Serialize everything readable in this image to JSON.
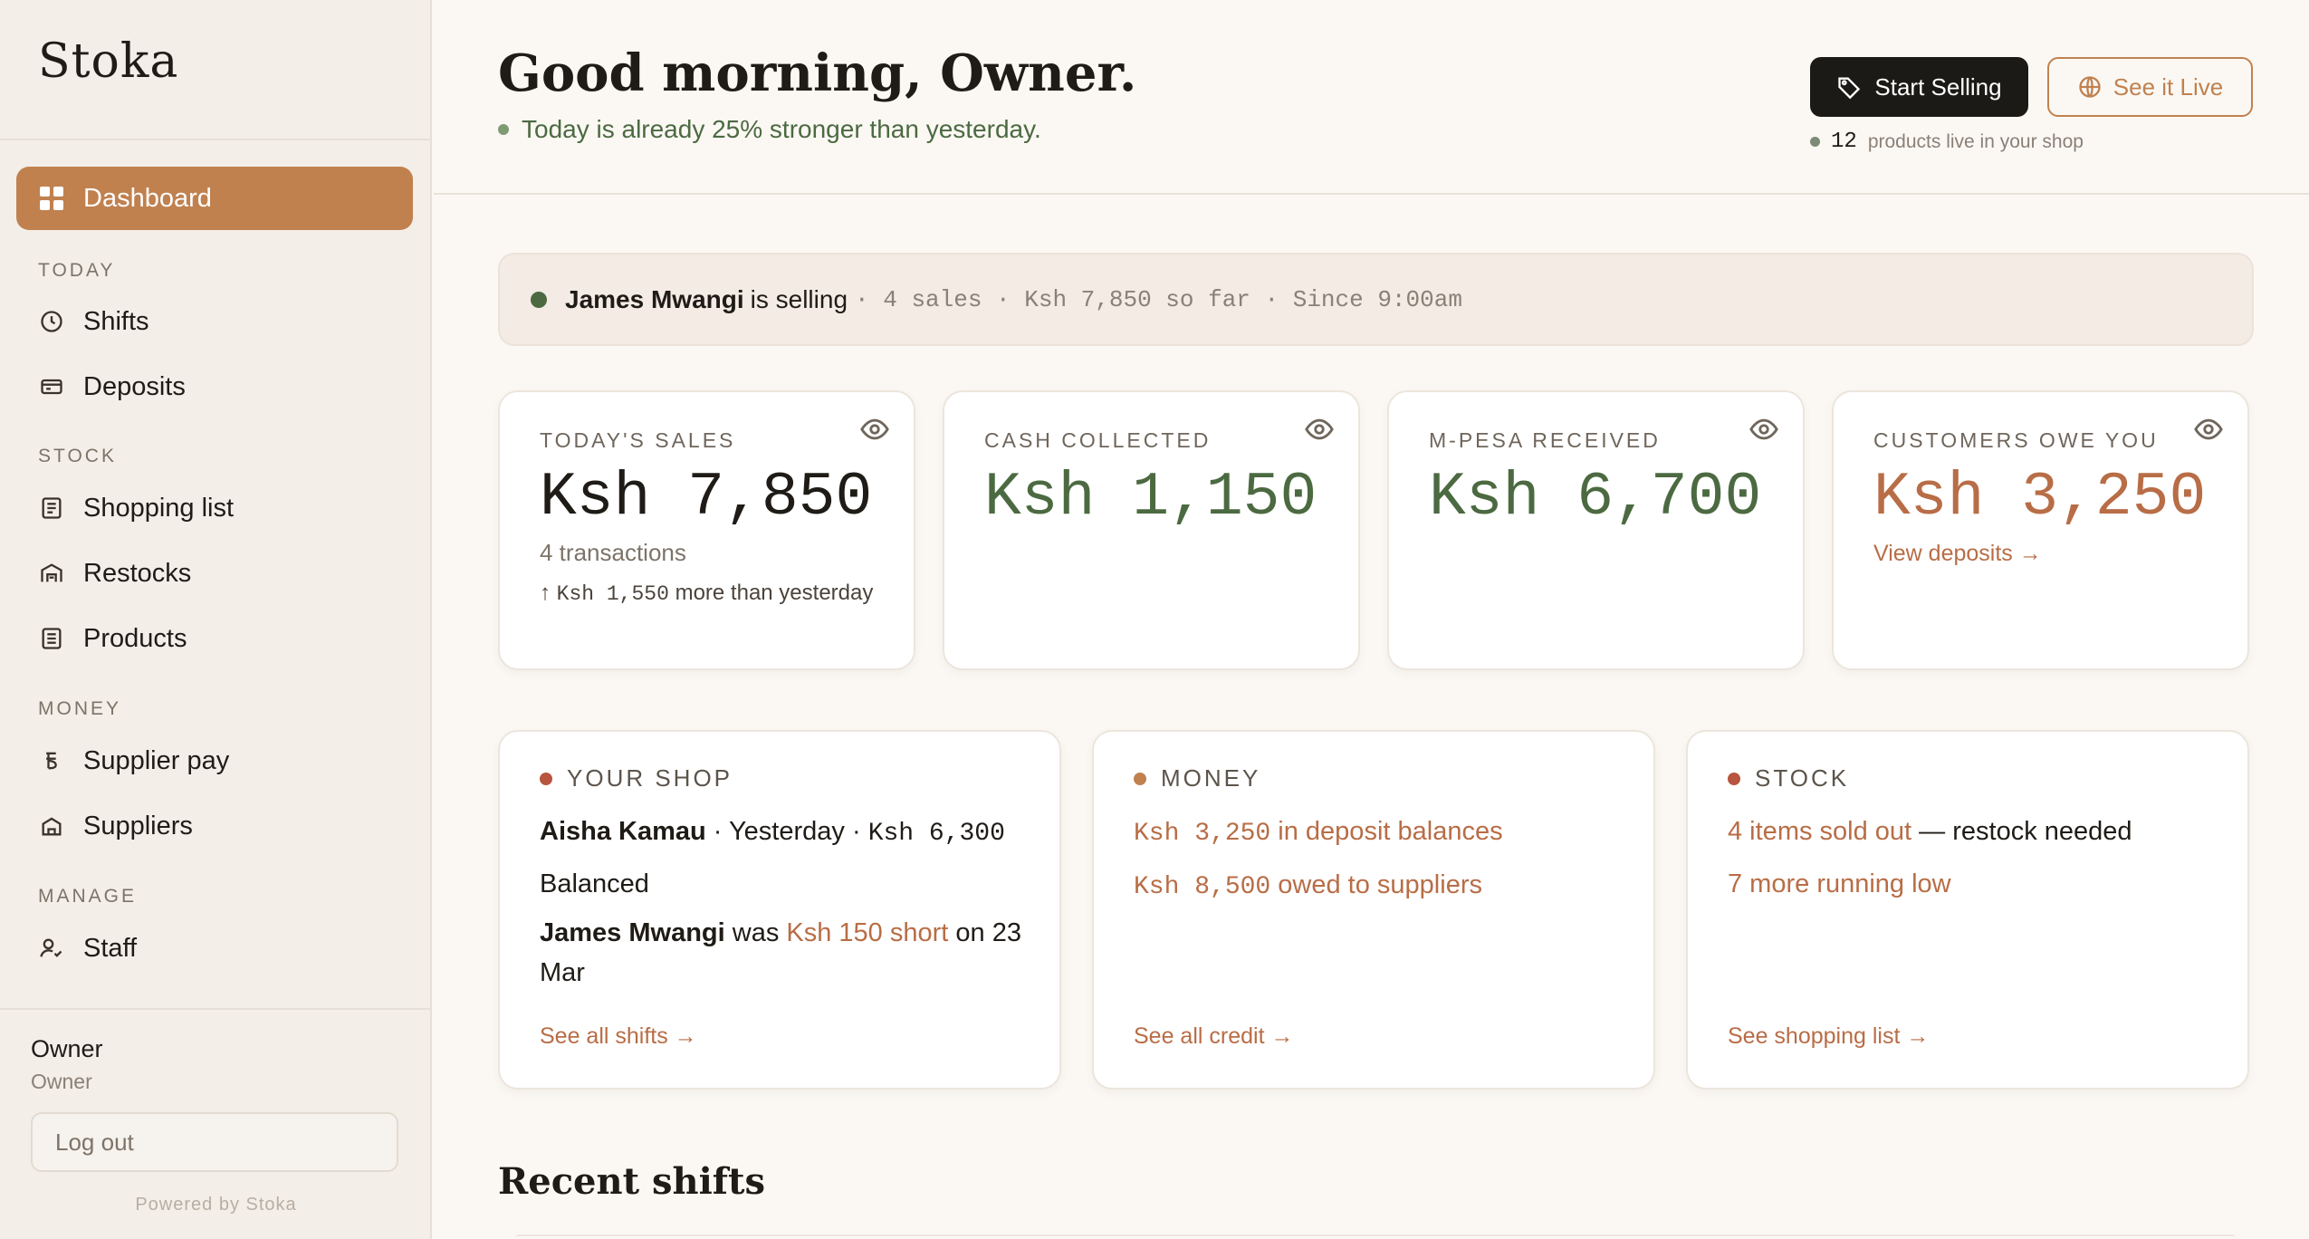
{
  "sidebar": {
    "brand": "Stoka",
    "active_item": "Dashboard",
    "sections": {
      "today": "TODAY",
      "stock": "STOCK",
      "money": "MONEY",
      "manage": "MANAGE"
    },
    "items": {
      "shifts": "Shifts",
      "deposits": "Deposits",
      "shopping_list": "Shopping list",
      "restocks": "Restocks",
      "products": "Products",
      "supplier_pay": "Supplier pay",
      "suppliers": "Suppliers",
      "staff": "Staff"
    },
    "user": {
      "name": "Owner",
      "role": "Owner"
    },
    "logout": "Log out",
    "powered_by": "Powered by Stoka"
  },
  "header": {
    "greeting": "Good morning, Owner.",
    "subtitle": "Today is already 25% stronger than yesterday.",
    "start_selling": "Start Selling",
    "see_live": "See it Live",
    "live_count": "12",
    "live_note": "products live in your shop"
  },
  "banner": {
    "name": "James Mwangi",
    "verb": "is selling",
    "meta": "· 4 sales · Ksh 7,850 so far · Since 9:00am"
  },
  "stats": {
    "sales": {
      "label": "TODAY'S SALES",
      "value": "Ksh 7,850",
      "transactions": "4 transactions",
      "delta_amount": "Ksh 1,550",
      "delta_text": "more than yesterday",
      "arrow": "↑"
    },
    "cash": {
      "label": "CASH COLLECTED",
      "value": "Ksh 1,150"
    },
    "mpesa": {
      "label": "M-PESA RECEIVED",
      "value": "Ksh 6,700"
    },
    "owe": {
      "label": "CUSTOMERS OWE YOU",
      "value": "Ksh 3,250",
      "link": "View deposits →"
    }
  },
  "cards": {
    "shop": {
      "title": "YOUR SHOP",
      "name": "Aisha Kamau",
      "when": "· Yesterday ·",
      "amount": "Ksh 6,300",
      "status": "Balanced",
      "name2": "James Mwangi",
      "was": "was",
      "short": "Ksh 150 short",
      "date": "on 23 Mar",
      "link": "See all shifts →"
    },
    "money": {
      "title": "MONEY",
      "amount1": "Ksh 3,250",
      "text1": "in deposit balances",
      "amount2": "Ksh 8,500",
      "text2": "owed to suppliers",
      "link": "See all credit →"
    },
    "stock": {
      "title": "STOCK",
      "sold_out": "4 items sold out",
      "restock": "— restock needed",
      "low": "7 more running low",
      "link": "See shopping list →"
    }
  },
  "recent_title": "Recent shifts",
  "colors": {
    "accent": "#c0814f",
    "green": "#4c6a41",
    "rust": "#b86d46"
  }
}
